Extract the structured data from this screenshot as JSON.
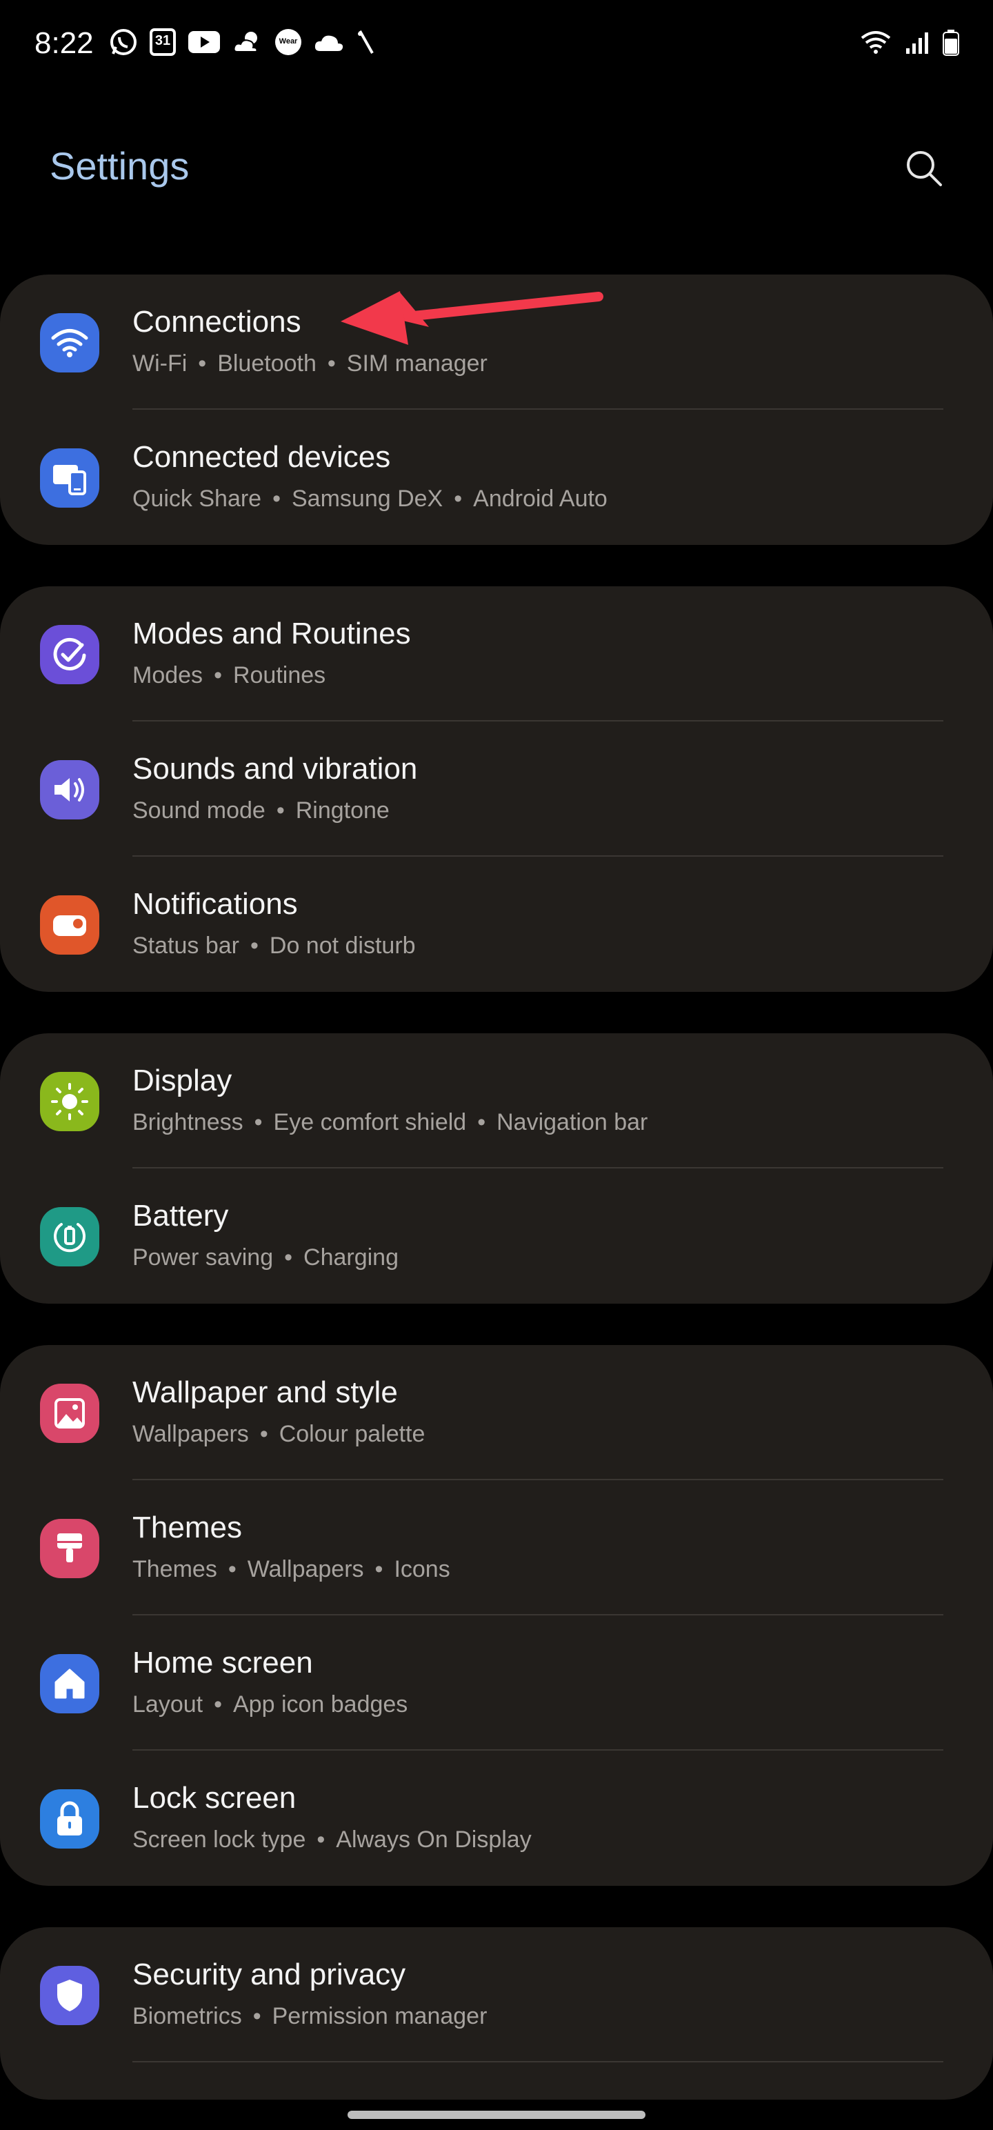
{
  "status_bar": {
    "time": "8:22",
    "calendar_day": "31",
    "wear_label": "Wear",
    "left_icons": [
      "whatsapp-icon",
      "calendar-icon",
      "youtube-icon",
      "weather-icon",
      "wear-icon",
      "cloud-icon",
      "slash-icon"
    ],
    "right_icons": [
      "wifi-icon",
      "signal-icon",
      "battery-icon"
    ]
  },
  "header": {
    "title": "Settings",
    "search_icon": "search-icon"
  },
  "groups": [
    {
      "items": [
        {
          "title": "Connections",
          "parts": [
            "Wi-Fi",
            "Bluetooth",
            "SIM manager"
          ],
          "icon": "wifi-icon",
          "color": "#3d6fe0"
        },
        {
          "title": "Connected devices",
          "parts": [
            "Quick Share",
            "Samsung DeX",
            "Android Auto"
          ],
          "icon": "devices-icon",
          "color": "#3d6fe0"
        }
      ]
    },
    {
      "items": [
        {
          "title": "Modes and Routines",
          "parts": [
            "Modes",
            "Routines"
          ],
          "icon": "check-circle-icon",
          "color": "#6b4fd8"
        },
        {
          "title": "Sounds and vibration",
          "parts": [
            "Sound mode",
            "Ringtone"
          ],
          "icon": "speaker-icon",
          "color": "#6b5fd8"
        },
        {
          "title": "Notifications",
          "parts": [
            "Status bar",
            "Do not disturb"
          ],
          "icon": "notification-icon",
          "color": "#e0562a"
        }
      ]
    },
    {
      "items": [
        {
          "title": "Display",
          "parts": [
            "Brightness",
            "Eye comfort shield",
            "Navigation bar"
          ],
          "icon": "sun-icon",
          "color": "#8ab81c"
        },
        {
          "title": "Battery",
          "parts": [
            "Power saving",
            "Charging"
          ],
          "icon": "battery-cycle-icon",
          "color": "#1f9a86"
        }
      ]
    },
    {
      "items": [
        {
          "title": "Wallpaper and style",
          "parts": [
            "Wallpapers",
            "Colour palette"
          ],
          "icon": "image-icon",
          "color": "#d9476a"
        },
        {
          "title": "Themes",
          "parts": [
            "Themes",
            "Wallpapers",
            "Icons"
          ],
          "icon": "brush-icon",
          "color": "#d9476a"
        },
        {
          "title": "Home screen",
          "parts": [
            "Layout",
            "App icon badges"
          ],
          "icon": "home-icon",
          "color": "#3d6fe0"
        },
        {
          "title": "Lock screen",
          "parts": [
            "Screen lock type",
            "Always On Display"
          ],
          "icon": "lock-icon",
          "color": "#2d7fe0"
        }
      ]
    },
    {
      "items": [
        {
          "title": "Security and privacy",
          "parts": [
            "Biometrics",
            "Permission manager"
          ],
          "icon": "shield-icon",
          "color": "#5f5fe0"
        }
      ]
    }
  ],
  "annotation": {
    "arrow_color": "#f2394b"
  }
}
